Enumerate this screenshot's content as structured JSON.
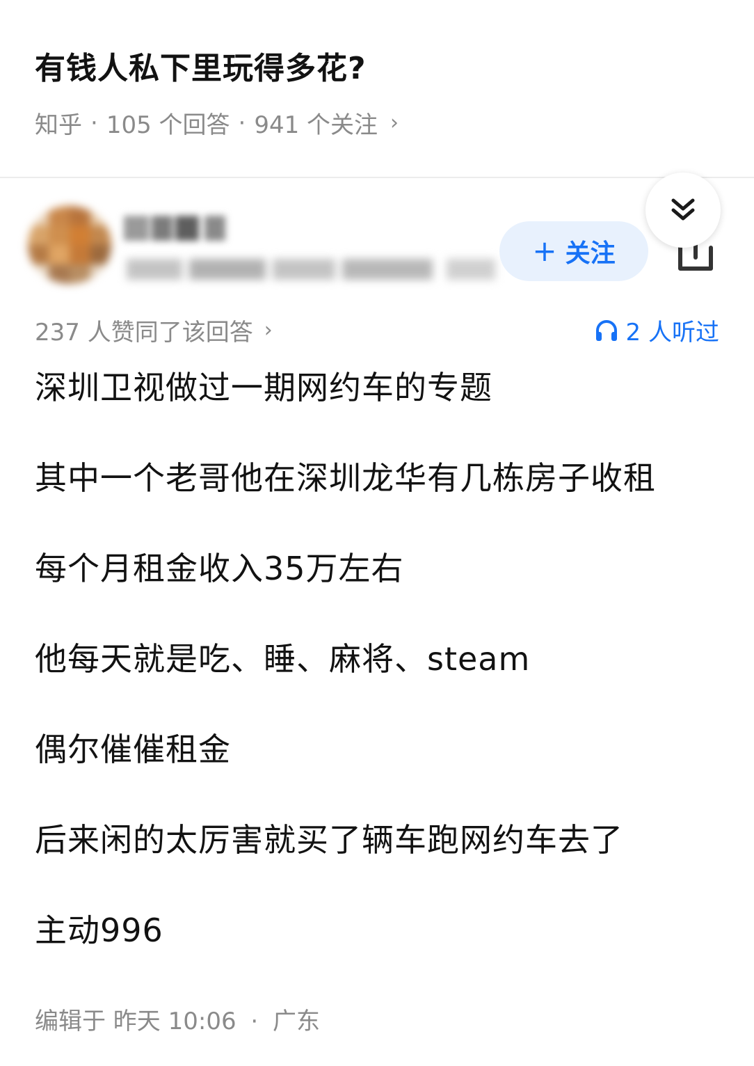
{
  "question": {
    "title": "有钱人私下里玩得多花?",
    "source": "知乎",
    "answers": "105 个回答",
    "followers": "941 个关注"
  },
  "author": {
    "follow_label": "关注"
  },
  "answer": {
    "votes": "237 人赞同了该回答",
    "listened": "2 人听过",
    "paragraphs": [
      "深圳卫视做过一期网约车的专题",
      "其中一个老哥他在深圳龙华有几栋房子收租",
      "每个月租金收入35万左右",
      "他每天就是吃、睡、麻将、steam",
      "偶尔催催租金",
      "后来闲的太厉害就买了辆车跑网约车去了",
      "主动996"
    ],
    "edited": "编辑于 昨天 10:06",
    "location": "广东"
  },
  "icons": {
    "collapse": "double-chevron-down-icon",
    "share": "share-icon",
    "headphones": "headphones-icon",
    "follow_plus": "plus-icon"
  },
  "colors": {
    "accent": "#1772f6",
    "follow_bg": "#e8f1fd",
    "meta_text": "#8a8a8a"
  }
}
